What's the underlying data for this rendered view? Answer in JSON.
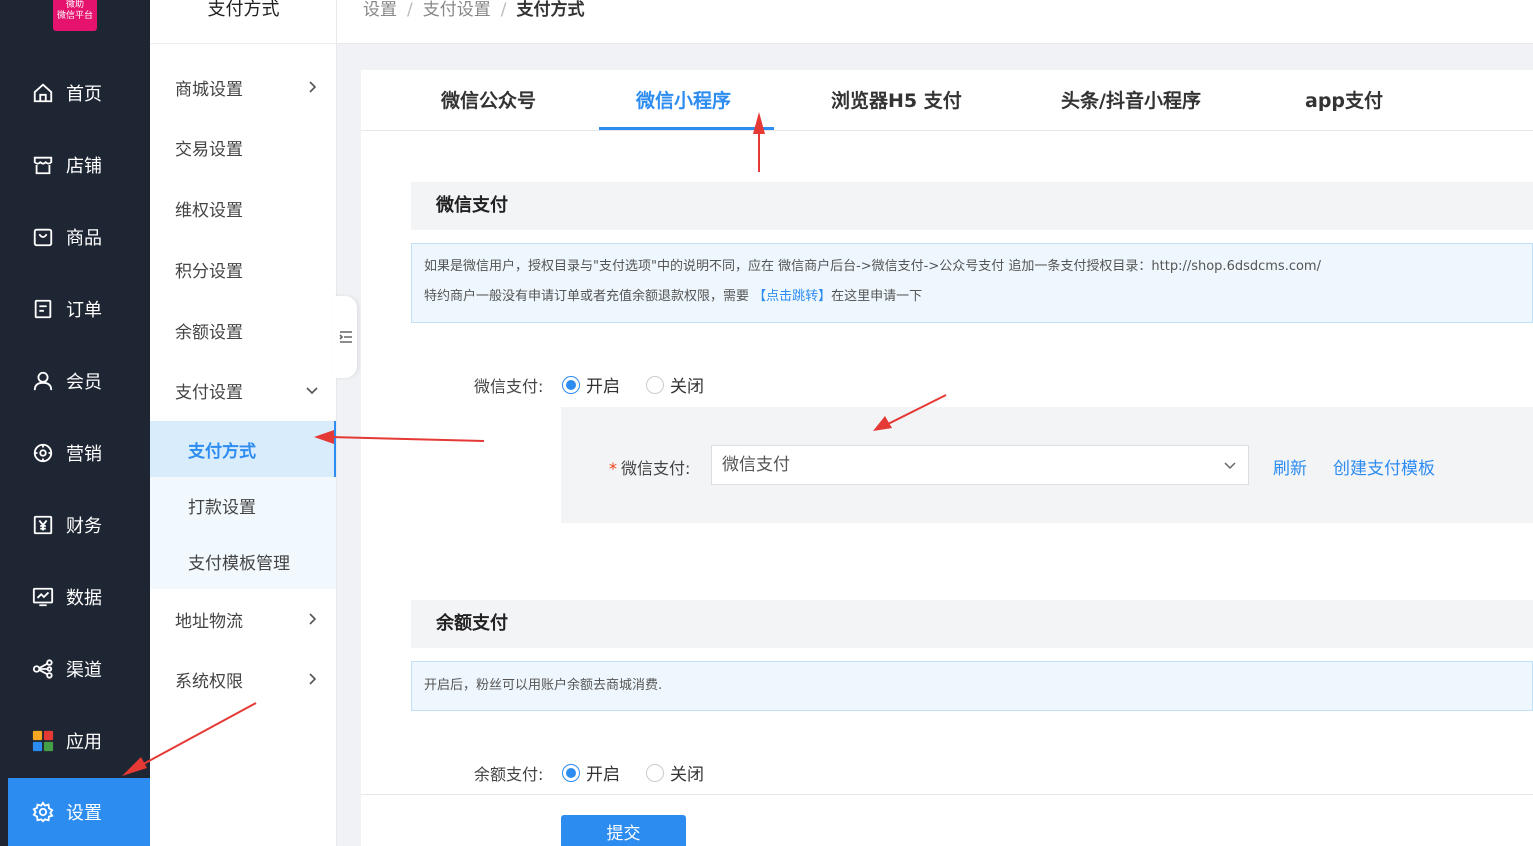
{
  "logo": {
    "line1": "微助",
    "line2": "微信平台"
  },
  "sidebar": {
    "items": [
      {
        "label": "首页",
        "icon": "home-icon"
      },
      {
        "label": "店铺",
        "icon": "shop-icon"
      },
      {
        "label": "商品",
        "icon": "bag-icon"
      },
      {
        "label": "订单",
        "icon": "order-icon"
      },
      {
        "label": "会员",
        "icon": "user-icon"
      },
      {
        "label": "营销",
        "icon": "marketing-icon"
      },
      {
        "label": "财务",
        "icon": "finance-icon"
      },
      {
        "label": "数据",
        "icon": "data-icon"
      },
      {
        "label": "渠道",
        "icon": "channel-icon"
      },
      {
        "label": "应用",
        "icon": "apps-icon"
      },
      {
        "label": "设置",
        "icon": "gear-icon",
        "active": true
      }
    ]
  },
  "submenu": {
    "title": "支付方式",
    "items": [
      {
        "label": "商城设置"
      },
      {
        "label": "交易设置"
      },
      {
        "label": "维权设置"
      },
      {
        "label": "积分设置"
      },
      {
        "label": "余额设置"
      },
      {
        "label": "支付设置"
      },
      {
        "label": "地址物流"
      },
      {
        "label": "系统权限"
      }
    ],
    "children": [
      {
        "label": "支付方式",
        "active": true
      },
      {
        "label": "打款设置"
      },
      {
        "label": "支付模板管理"
      }
    ]
  },
  "breadcrumb": {
    "items": [
      "设置",
      "支付设置",
      "支付方式"
    ],
    "separator": "/"
  },
  "tabs": [
    {
      "label": "微信公众号"
    },
    {
      "label": "微信小程序",
      "active": true
    },
    {
      "label": "浏览器H5 支付"
    },
    {
      "label": "头条/抖音小程序"
    },
    {
      "label": "app支付"
    }
  ],
  "wechat_pay": {
    "section_title": "微信支付",
    "notice_line1": "如果是微信用户，授权目录与\"支付选项\"中的说明不同，应在 微信商户后台->微信支付->公众号支付 追加一条支付授权目录：http://shop.6dsdcms.com/",
    "notice_line2_prefix": "特约商户一般没有申请订单或者充值余额退款权限，需要 ",
    "notice_link": "【点击跳转】",
    "notice_line2_suffix": "在这里申请一下",
    "toggle_label": "微信支付:",
    "on_label": "开启",
    "off_label": "关闭",
    "select_label": "微信支付:",
    "select_value": "微信支付",
    "refresh_label": "刷新",
    "create_template_label": "创建支付模板"
  },
  "balance_pay": {
    "section_title": "余额支付",
    "notice": "开启后，粉丝可以用账户余额去商城消费.",
    "toggle_label": "余额支付:",
    "on_label": "开启",
    "off_label": "关闭"
  },
  "submit_label": "提交",
  "colors": {
    "accent": "#2d8cf0",
    "sidebar_bg": "#1f2633",
    "annotation": "#e53935",
    "logo": "#e5126e"
  }
}
